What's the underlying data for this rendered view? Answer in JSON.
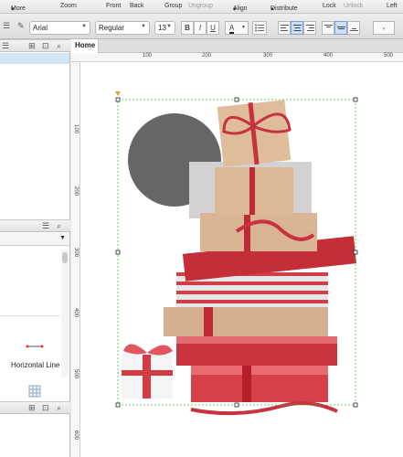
{
  "toolbar_labels": {
    "more": "More",
    "more_arrow": "▾",
    "zoom": "Zoom",
    "front": "Front",
    "back": "Back",
    "group": "Group",
    "ungroup": "Ungroup",
    "align": "Align",
    "align_arrow": "▾",
    "distribute": "Distribute",
    "distribute_arrow": "▾",
    "lock": "Lock",
    "unlock": "Unlock",
    "left": "Left"
  },
  "format": {
    "font_family": "Arial",
    "font_style": "Regular",
    "font_size": "13",
    "bold": "B",
    "italic": "I",
    "underline": "U",
    "text_color": "A"
  },
  "left_panel": {
    "hline_label": "Horizontal Line"
  },
  "tabs": {
    "home": "Home"
  },
  "rulers": {
    "h": [
      "100",
      "200",
      "300",
      "400",
      "500"
    ],
    "v": [
      "100",
      "200",
      "300",
      "400",
      "500",
      "600"
    ]
  },
  "colors": {
    "selection": "#3cc43c",
    "circle": "#666666",
    "rect": "#d2d2d2",
    "accent": "#4a90e2"
  },
  "icons": [
    "pages-list-icon",
    "add-folder-icon",
    "search-icon",
    "hamburger-icon",
    "add-page-icon"
  ]
}
